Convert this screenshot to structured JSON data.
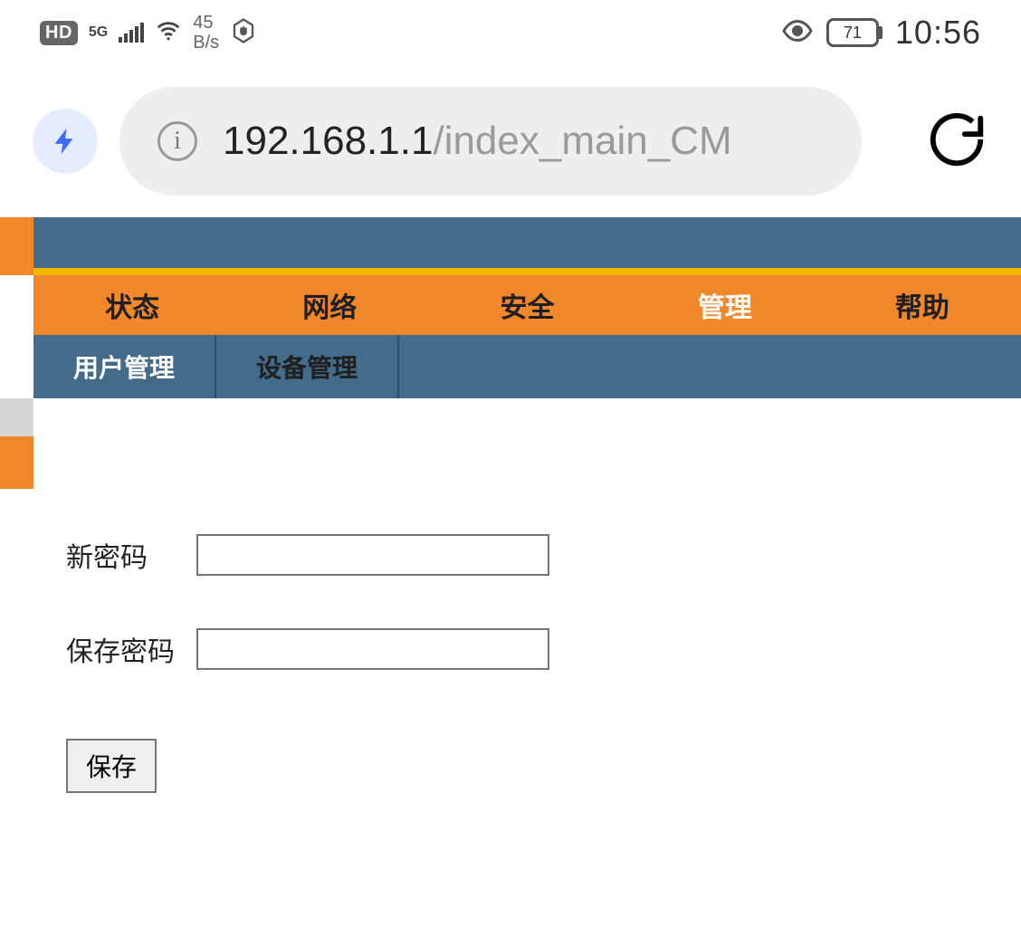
{
  "status_bar": {
    "hd_label": "HD",
    "network_type": "5G",
    "speed_value": "45",
    "speed_unit": "B/s",
    "battery_percent": "71",
    "clock": "10:56"
  },
  "browser": {
    "url_host": "192.168.1.1",
    "url_path": "/index_main_CM"
  },
  "nav": {
    "tabs": [
      {
        "label": "状态"
      },
      {
        "label": "网络"
      },
      {
        "label": "安全"
      },
      {
        "label": "管理",
        "active": true
      },
      {
        "label": "帮助"
      }
    ],
    "subtabs": [
      {
        "label": "用户管理",
        "active": true
      },
      {
        "label": "设备管理"
      }
    ]
  },
  "form": {
    "new_password_label": "新密码",
    "confirm_password_label": "保存密码",
    "save_button": "保存"
  }
}
